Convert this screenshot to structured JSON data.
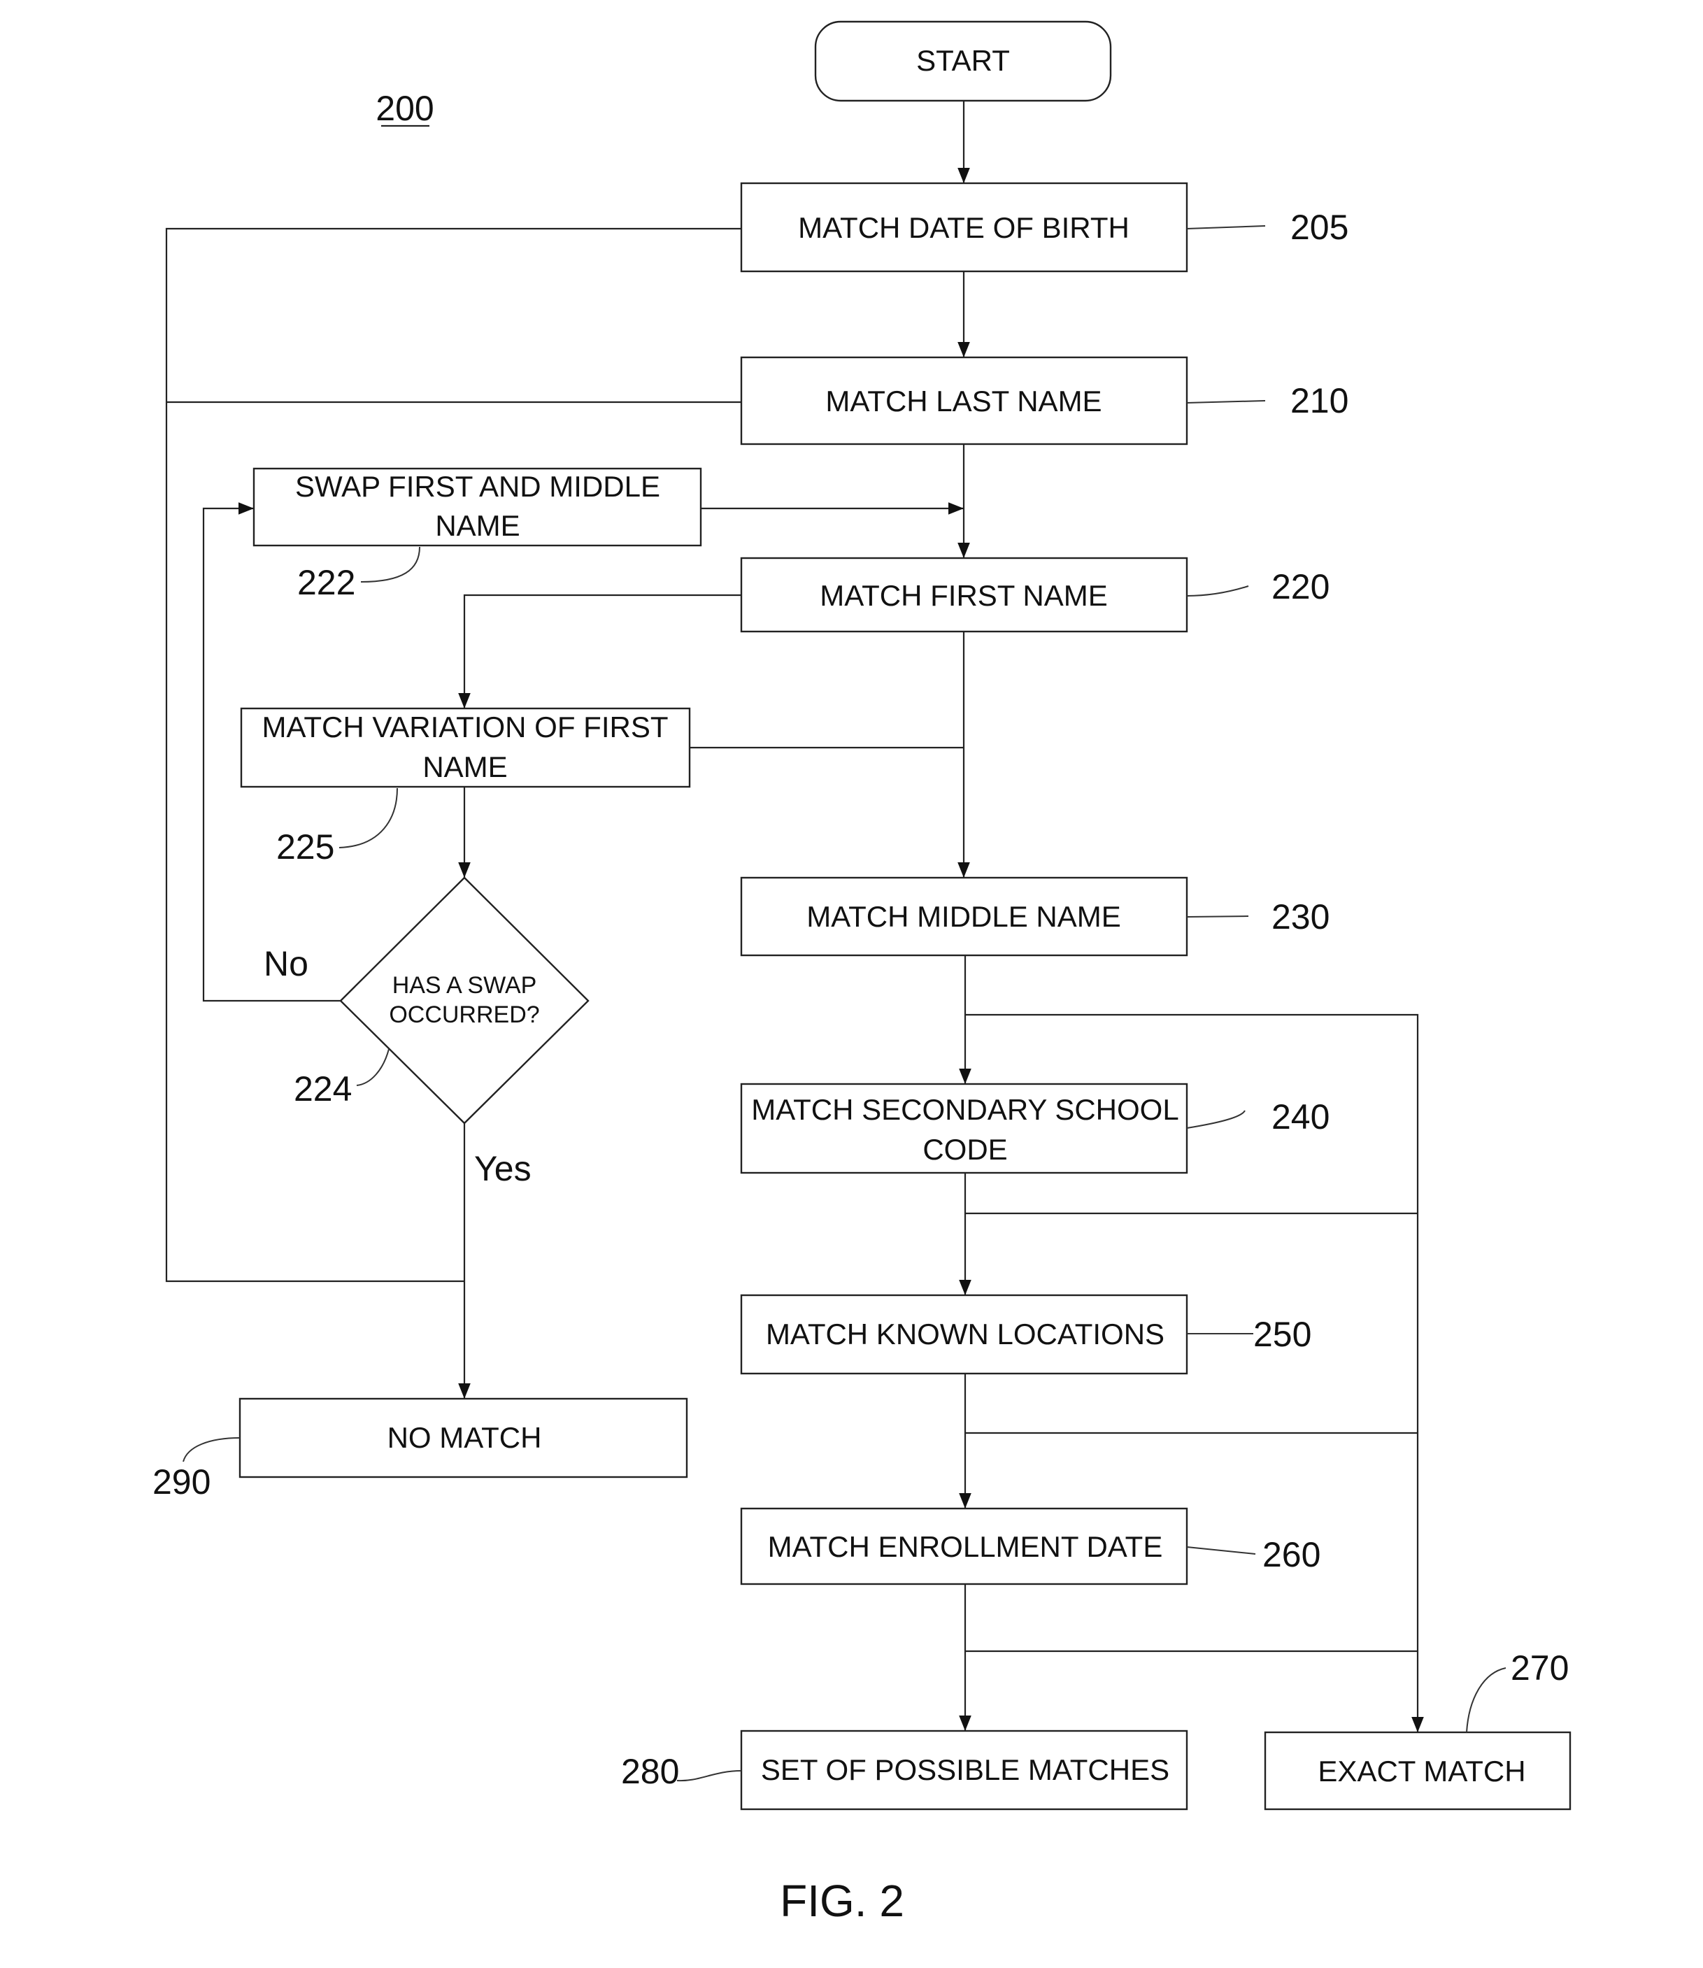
{
  "figure": {
    "number_label": "200",
    "caption": "FIG. 2"
  },
  "nodes": {
    "start": {
      "label": [
        "START"
      ]
    },
    "dob": {
      "label": [
        "MATCH DATE OF BIRTH"
      ],
      "ref": "205"
    },
    "last_name": {
      "label": [
        "MATCH LAST NAME"
      ],
      "ref": "210"
    },
    "swap": {
      "label": [
        "SWAP FIRST AND MIDDLE",
        "NAME"
      ],
      "ref": "222"
    },
    "first_name": {
      "label": [
        "MATCH FIRST NAME"
      ],
      "ref": "220"
    },
    "variation": {
      "label": [
        "MATCH VARIATION OF FIRST",
        "NAME"
      ],
      "ref": "225"
    },
    "swap_decision": {
      "label": [
        "HAS A SWAP",
        "OCCURRED?"
      ],
      "ref": "224",
      "no_label": "No",
      "yes_label": "Yes"
    },
    "middle_name": {
      "label": [
        "MATCH MIDDLE NAME"
      ],
      "ref": "230"
    },
    "school_code": {
      "label": [
        "MATCH SECONDARY SCHOOL",
        "CODE"
      ],
      "ref": "240"
    },
    "locations": {
      "label": [
        "MATCH  KNOWN LOCATIONS"
      ],
      "ref": "250"
    },
    "enrollment": {
      "label": [
        "MATCH  ENROLLMENT DATE"
      ],
      "ref": "260"
    },
    "no_match": {
      "label": [
        "NO MATCH"
      ],
      "ref": "290"
    },
    "possible_matches": {
      "label": [
        "SET OF POSSIBLE MATCHES"
      ],
      "ref": "280"
    },
    "exact_match": {
      "label": [
        "EXACT MATCH"
      ],
      "ref": "270"
    }
  }
}
